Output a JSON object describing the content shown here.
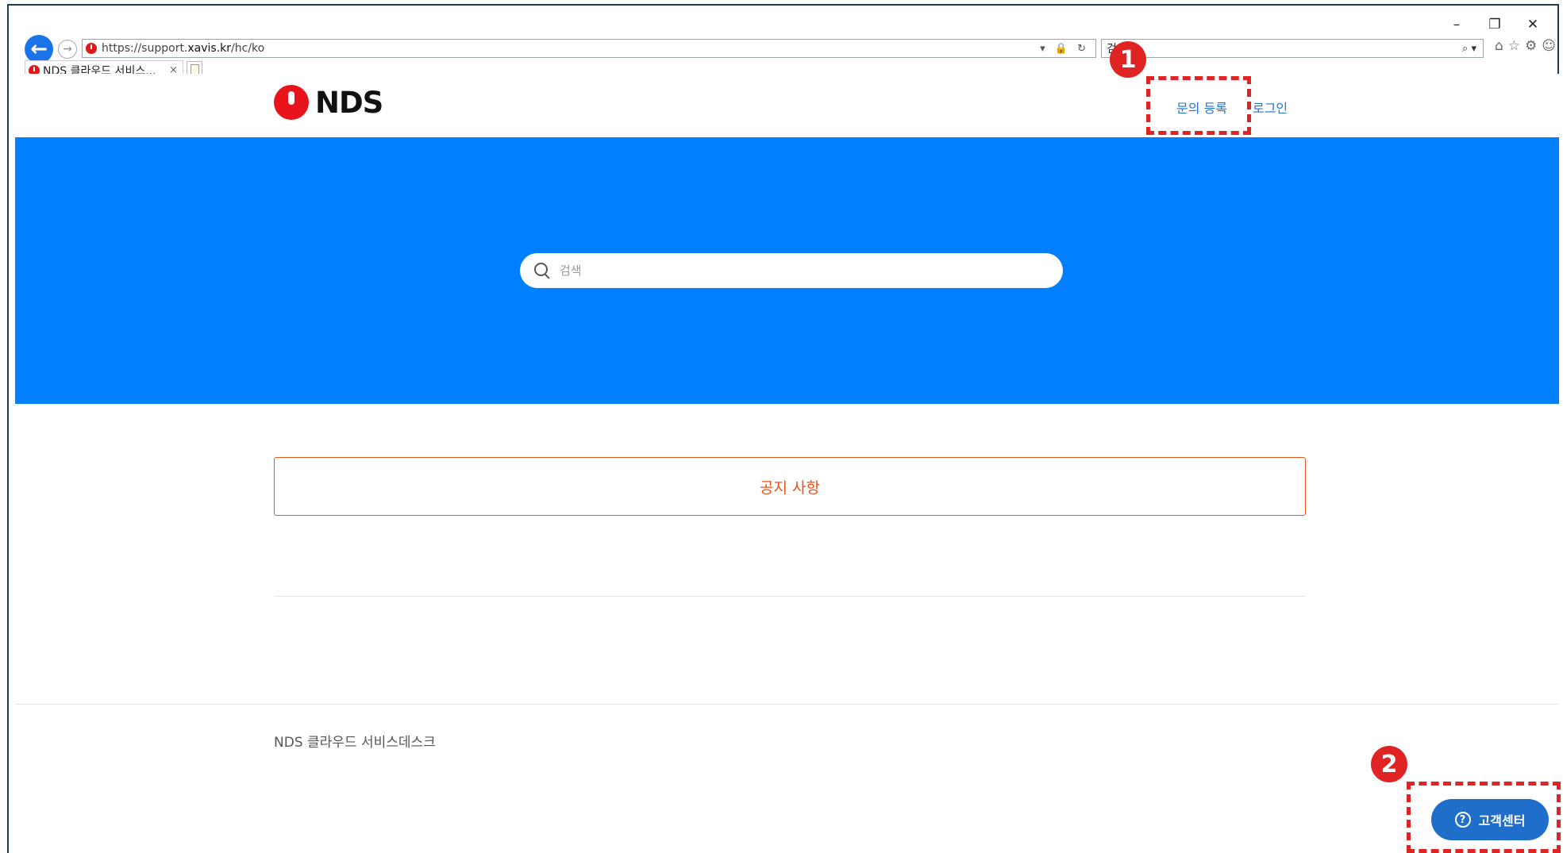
{
  "browser": {
    "url_prefix": "https://support.",
    "url_host": "xavis.kr",
    "url_path": "/hc/ko",
    "addr_icons": "▾ 🔒 ↻",
    "search_value": "검색",
    "search_icons": "⌕ ▾",
    "tab_title": "NDS 클라우드 서비스...",
    "tab_close": "×",
    "window_controls": {
      "minimize": "–",
      "restore": "❐",
      "close": "✕"
    },
    "tool_icons": {
      "home": "⌂",
      "favorites": "☆",
      "settings": "⚙",
      "feedback": "☺"
    }
  },
  "header": {
    "logo_text": "NDS",
    "nav": {
      "submit_request": "문의 등록",
      "login": "로그인"
    }
  },
  "hero": {
    "search_placeholder": "검색"
  },
  "main": {
    "notice_label": "공지 사항"
  },
  "footer": {
    "site_name": "NDS 클라우드 서비스데스크"
  },
  "help_widget": {
    "label": "고객센터",
    "icon_glyph": "?"
  },
  "annotations": [
    {
      "number": "1"
    },
    {
      "number": "2"
    }
  ],
  "colors": {
    "hero_blue": "#0080ff",
    "link_blue": "#1f73d9",
    "notice_orange": "#e8521b",
    "logo_red": "#e8141c",
    "annotation_red": "#e02424",
    "help_button": "#1f6ec9"
  }
}
